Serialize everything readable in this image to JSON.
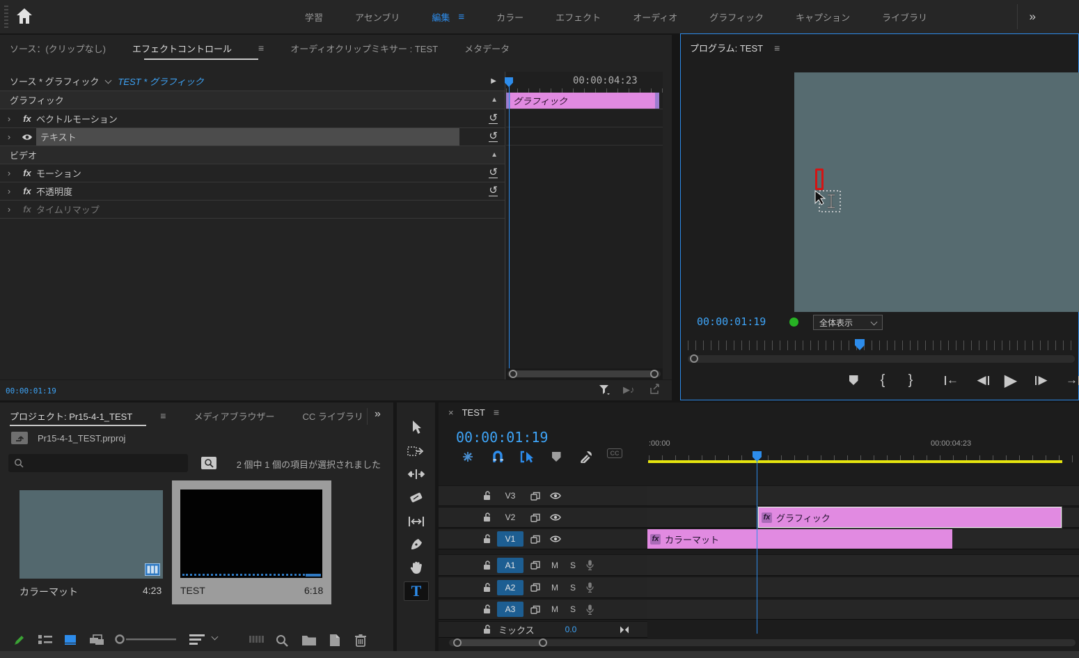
{
  "colors": {
    "accent_blue": "#2d8ceb",
    "timecode_blue": "#3ea4f7",
    "clip_pink": "#e18ae1",
    "clip_edge_purple": "#9d7cd0",
    "render_bar_yellow": "#e6e50f",
    "video_teal": "#566b70",
    "track_target_blue": "#1d5e92",
    "status_green": "#27b324",
    "caret_red": "#d41414"
  },
  "icons": {
    "menu": "≡",
    "overflow": "»",
    "collapse_up": "▲",
    "chevron_right": "›",
    "disclosure_right": "▶",
    "fx": "fx",
    "reset": "↺",
    "close": "×",
    "mark_in": "{",
    "mark_out": "}",
    "tri_left": "◀",
    "tri_right": "▶",
    "arrow_left": "←",
    "arrow_right": "→",
    "note": "♪"
  },
  "top_bar": {
    "active_tab": "編集",
    "tabs": [
      "学習",
      "アセンブリ",
      "編集",
      "カラー",
      "エフェクト",
      "オーディオ",
      "グラフィック",
      "キャプション",
      "ライブラリ"
    ]
  },
  "effect_controls": {
    "tabs": [
      "ソース：(クリップなし)",
      "エフェクトコントロール",
      "オーディオクリップミキサー : TEST",
      "メタデータ"
    ],
    "active_tab": "エフェクトコントロール",
    "source_label": "ソース * グラフィック",
    "clip_label": "TEST * グラフィック",
    "rows": [
      {
        "label": "グラフィック",
        "kind": "header"
      },
      {
        "label": "ベクトルモーション",
        "kind": "effect"
      },
      {
        "label": "テキスト",
        "kind": "effect-selected"
      },
      {
        "label": "ビデオ",
        "kind": "header"
      },
      {
        "label": "モーション",
        "kind": "effect"
      },
      {
        "label": "不透明度",
        "kind": "effect"
      },
      {
        "label": "タイムリマップ",
        "kind": "effect-disabled"
      }
    ],
    "mini_timeline": {
      "end_timecode": "00:00:04:23",
      "clip_label": "グラフィック"
    },
    "current_timecode": "00:00:01:19"
  },
  "program_monitor": {
    "title": "プログラム: TEST",
    "timecode": "00:00:01:19",
    "zoom_level": "全体表示"
  },
  "project_panel": {
    "tabs": [
      "プロジェクト: Pr15-4-1_TEST",
      "メディアブラウザー",
      "CC ライブラリ"
    ],
    "active_tab": "プロジェクト: Pr15-4-1_TEST",
    "overflow": "»",
    "project_file": "Pr15-4-1_TEST.prproj",
    "search_value": "",
    "status": "2 個中 1 個の項目が選択されました",
    "items": [
      {
        "name": "カラーマット",
        "duration": "4:23",
        "selected": false
      },
      {
        "name": "TEST",
        "duration": "6:18",
        "selected": true
      }
    ]
  },
  "timeline": {
    "tab": "TEST",
    "timecode": "00:00:01:19",
    "ruler": {
      "start_label": ":00:00",
      "end_label": "00:00:04:23"
    },
    "video_tracks": [
      {
        "name": "V3",
        "targeted": false
      },
      {
        "name": "V2",
        "targeted": false
      },
      {
        "name": "V1",
        "targeted": true
      }
    ],
    "audio_tracks": [
      {
        "name": "A1",
        "targeted": true
      },
      {
        "name": "A2",
        "targeted": true
      },
      {
        "name": "A3",
        "targeted": true
      }
    ],
    "audio_buttons": {
      "mute": "M",
      "solo": "S"
    },
    "mix": {
      "label": "ミックス",
      "value": "0.0"
    },
    "clips": [
      {
        "track": "V2",
        "label": "グラフィック",
        "selected": true
      },
      {
        "track": "V1",
        "label": "カラーマット",
        "selected": false
      }
    ]
  }
}
